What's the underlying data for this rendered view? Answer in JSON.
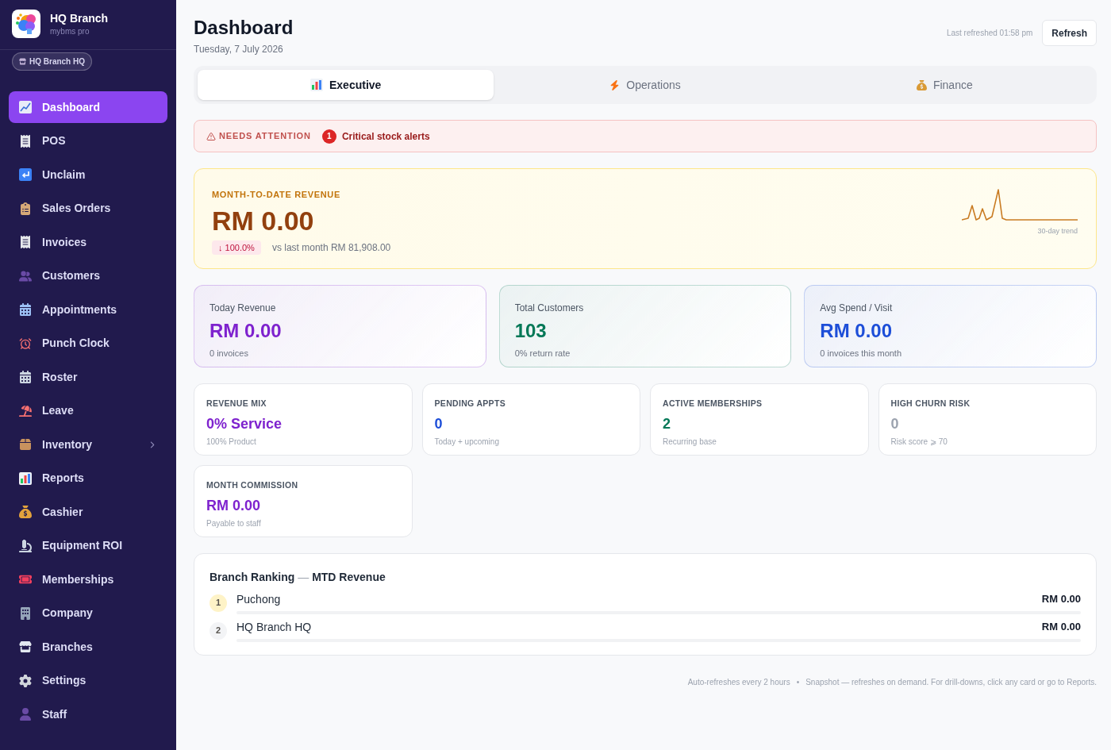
{
  "sidebar": {
    "app_name": "HQ Branch",
    "app_subtitle": "mybms pro",
    "branch_chip": "HQ Branch HQ",
    "items": [
      {
        "label": "Dashboard",
        "selected": true,
        "kind": "link"
      },
      {
        "label": "POS",
        "selected": false,
        "kind": "link"
      },
      {
        "label": "Unclaim",
        "selected": false,
        "kind": "link"
      },
      {
        "label": "Sales Orders",
        "selected": false,
        "kind": "link"
      },
      {
        "label": "Invoices",
        "selected": false,
        "kind": "link"
      },
      {
        "label": "Customers",
        "selected": false,
        "kind": "link"
      },
      {
        "label": "Appointments",
        "selected": false,
        "kind": "link"
      },
      {
        "label": "Punch Clock",
        "selected": false,
        "kind": "link"
      },
      {
        "label": "Roster",
        "selected": false,
        "kind": "link"
      },
      {
        "label": "Leave",
        "selected": false,
        "kind": "link"
      },
      {
        "label": "Inventory",
        "selected": false,
        "kind": "submenu"
      },
      {
        "label": "Reports",
        "selected": false,
        "kind": "link"
      },
      {
        "label": "Cashier",
        "selected": false,
        "kind": "link"
      },
      {
        "label": "Equipment ROI",
        "selected": false,
        "kind": "link"
      },
      {
        "label": "Memberships",
        "selected": false,
        "kind": "link"
      },
      {
        "label": "Company",
        "selected": false,
        "kind": "link"
      },
      {
        "label": "Branches",
        "selected": false,
        "kind": "link"
      },
      {
        "label": "Settings",
        "selected": false,
        "kind": "link"
      },
      {
        "label": "Staff",
        "selected": false,
        "kind": "link"
      }
    ]
  },
  "header": {
    "title": "Dashboard",
    "date": "Tuesday, 7 July 2026",
    "last_refreshed": "Last refreshed 01:58 pm",
    "refresh_button": "Refresh"
  },
  "tabs": [
    {
      "label": "Executive",
      "selected": true
    },
    {
      "label": "Operations",
      "selected": false
    },
    {
      "label": "Finance",
      "selected": false
    }
  ],
  "attention": {
    "title": "NEEDS ATTENTION",
    "alerts": [
      {
        "count": "1",
        "label": "Critical stock alerts"
      }
    ]
  },
  "mtd_revenue": {
    "label": "MONTH-TO-DATE REVENUE",
    "value": "RM 0.00",
    "change": "↓ 100.0%",
    "comparison": "vs last month RM 81,908.00",
    "trend_label": "30-day trend"
  },
  "stat_cards": [
    {
      "label": "Today Revenue",
      "value": "RM 0.00",
      "note": "0 invoices",
      "color": "#7e22ce"
    },
    {
      "label": "Total Customers",
      "value": "103",
      "note": "0% return rate",
      "color": "#047857"
    },
    {
      "label": "Avg Spend / Visit",
      "value": "RM 0.00",
      "note": "0 invoices this month",
      "color": "#1d4ed8"
    }
  ],
  "kpi_cards": [
    {
      "label": "REVENUE MIX",
      "value": "0% Service",
      "note": "100% Product",
      "color": "#7e22ce"
    },
    {
      "label": "PENDING APPTS",
      "value": "0",
      "note": "Today + upcoming",
      "color": "#1d4ed8"
    },
    {
      "label": "ACTIVE MEMBERSHIPS",
      "value": "2",
      "note": "Recurring base",
      "color": "#047857"
    },
    {
      "label": "HIGH CHURN RISK",
      "value": "0",
      "note": "Risk score ⩾ 70",
      "color": "#9ca3af"
    },
    {
      "label": "MONTH COMMISSION",
      "value": "RM 0.00",
      "note": "Payable to staff",
      "color": "#7e22ce"
    }
  ],
  "branch_ranking": {
    "title": "Branch Ranking",
    "separator": "—",
    "subtitle": "MTD Revenue",
    "rows": [
      {
        "rank": "1",
        "name": "Puchong",
        "amount": "RM 0.00",
        "color": "#fef3c7"
      },
      {
        "rank": "2",
        "name": "HQ Branch HQ",
        "amount": "RM 0.00",
        "color": "#f3f4f6"
      }
    ]
  },
  "footer": {
    "auto_refresh": "Auto-refreshes every 2 hours",
    "separator": "•",
    "note": "Snapshot — refreshes on demand. For drill-downs, click any card or go to Reports."
  }
}
